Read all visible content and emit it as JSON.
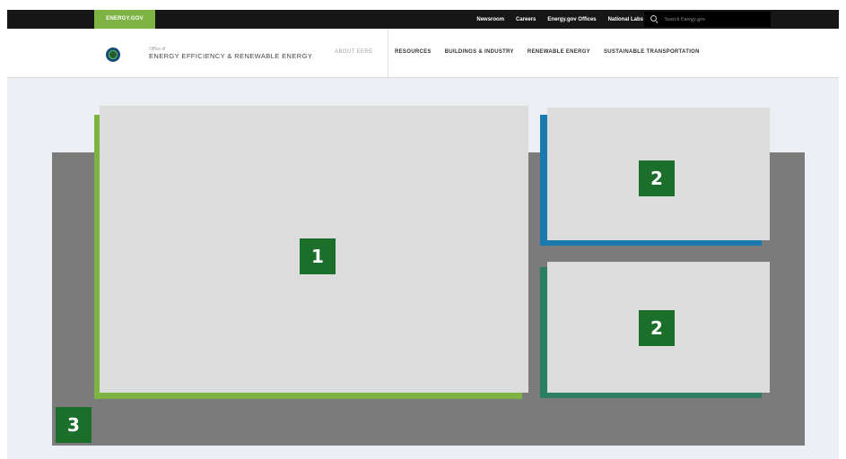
{
  "topbar": {
    "brand": "ENERGY.GOV",
    "links": [
      "Newsroom",
      "Careers",
      "Energy.gov Offices",
      "National Labs"
    ],
    "search": {
      "placeholder": "Search Energy.gov"
    }
  },
  "header": {
    "office_of": "Office of",
    "office_name": "ENERGY EFFICIENCY & RENEWABLE ENERGY",
    "nav_about": "ABOUT EERE",
    "nav_items": [
      "RESOURCES",
      "BUILDINGS & INDUSTRY",
      "RENEWABLE ENERGY",
      "SUSTAINABLE TRANSPORTATION"
    ]
  },
  "layout_regions": {
    "primary_label": "1",
    "secondary_top_label": "2",
    "secondary_bottom_label": "2",
    "background_label": "3"
  },
  "colors": {
    "topbar": "#161616",
    "brand_green": "#7cb342",
    "badge_green": "#1b6f2a",
    "card_blue": "#1a7ab0",
    "card_teal": "#2a7f63",
    "region_gray": "#7b7b7b",
    "card_gray": "#dcdcdc"
  }
}
